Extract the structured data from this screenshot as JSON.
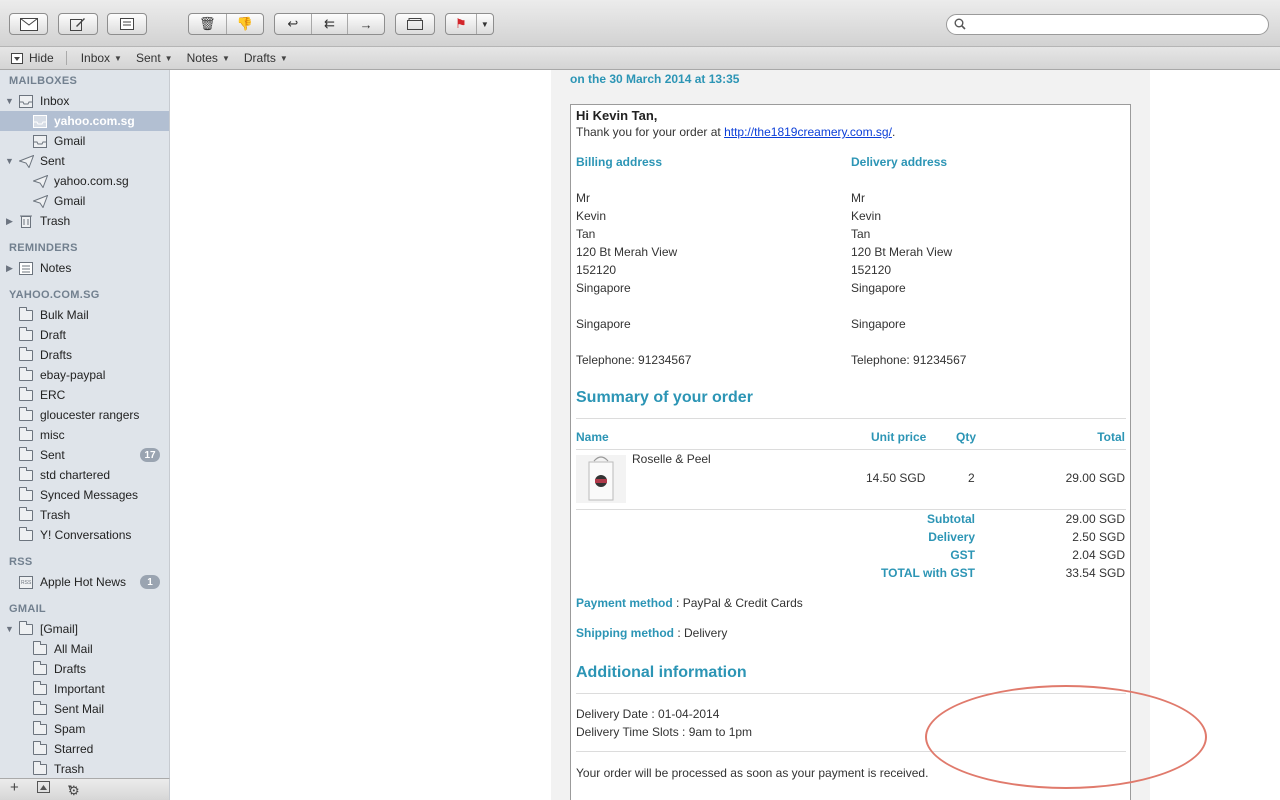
{
  "toolbar": {
    "search_placeholder": ""
  },
  "favorites": {
    "hide_label": "Hide",
    "items": [
      "Inbox",
      "Sent",
      "Notes",
      "Drafts"
    ]
  },
  "sidebar": {
    "mailboxes_header": "MAILBOXES",
    "inbox": "Inbox",
    "inbox_accounts": [
      "yahoo.com.sg",
      "Gmail"
    ],
    "sent": "Sent",
    "sent_accounts": [
      "yahoo.com.sg",
      "Gmail"
    ],
    "trash": "Trash",
    "reminders_header": "REMINDERS",
    "notes": "Notes",
    "yahoo_header": "YAHOO.COM.SG",
    "yahoo_folders": [
      "Bulk Mail",
      "Draft",
      "Drafts",
      "ebay-paypal",
      "ERC",
      "gloucester rangers",
      "misc",
      "Sent",
      "std chartered",
      "Synced Messages",
      "Trash",
      "Y! Conversations"
    ],
    "yahoo_sent_badge": "17",
    "rss_header": "RSS",
    "rss_feed": "Apple Hot News",
    "rss_badge": "1",
    "gmail_header": "GMAIL",
    "gmail_root": "[Gmail]",
    "gmail_folders": [
      "All Mail",
      "Drafts",
      "Important",
      "Sent Mail",
      "Spam",
      "Starred",
      "Trash"
    ]
  },
  "message": {
    "sent_line": "on the 30 March 2014 at 13:35",
    "greeting": "Hi Kevin Tan,",
    "thanks_prefix": "Thank you for your order at ",
    "shop_url": "http://the1819creamery.com.sg/",
    "thanks_suffix": ".",
    "billing_title": "Billing address",
    "delivery_title": "Delivery address",
    "billing_lines": [
      "Mr",
      "Kevin",
      "Tan",
      "120 Bt Merah View",
      "152120",
      "Singapore",
      "",
      "Singapore",
      "",
      "Telephone: 91234567"
    ],
    "delivery_lines": [
      "Mr",
      "Kevin",
      "Tan",
      "120 Bt Merah View",
      "152120",
      "Singapore",
      "",
      "Singapore",
      "",
      "Telephone: 91234567"
    ],
    "summary_title": "Summary of your order",
    "col_name": "Name",
    "col_unit_price": "Unit price",
    "col_qty": "Qty",
    "col_total": "Total",
    "product_name": "Roselle & Peel",
    "product_unit_price": "14.50 SGD",
    "product_qty": "2",
    "product_total": "29.00 SGD",
    "totals": [
      {
        "label": "Subtotal",
        "value": "29.00 SGD"
      },
      {
        "label": "Delivery",
        "value": "2.50 SGD"
      },
      {
        "label": "GST",
        "value": "2.04 SGD"
      },
      {
        "label": "TOTAL with GST",
        "value": "33.54 SGD"
      }
    ],
    "payment_label": "Payment method",
    "payment_value": " : PayPal & Credit Cards",
    "shipping_label": "Shipping method",
    "shipping_value": " : Delivery",
    "additional_title": "Additional information",
    "delivery_date": "Delivery Date : 01-04-2014",
    "delivery_slots": "Delivery Time Slots : 9am to 1pm",
    "processing_note": "Your order will be processed as soon as your payment is received."
  },
  "colors": {
    "accent": "#2c95b5",
    "selection": "#b2bfd2",
    "annotation": "#e07a6c"
  }
}
